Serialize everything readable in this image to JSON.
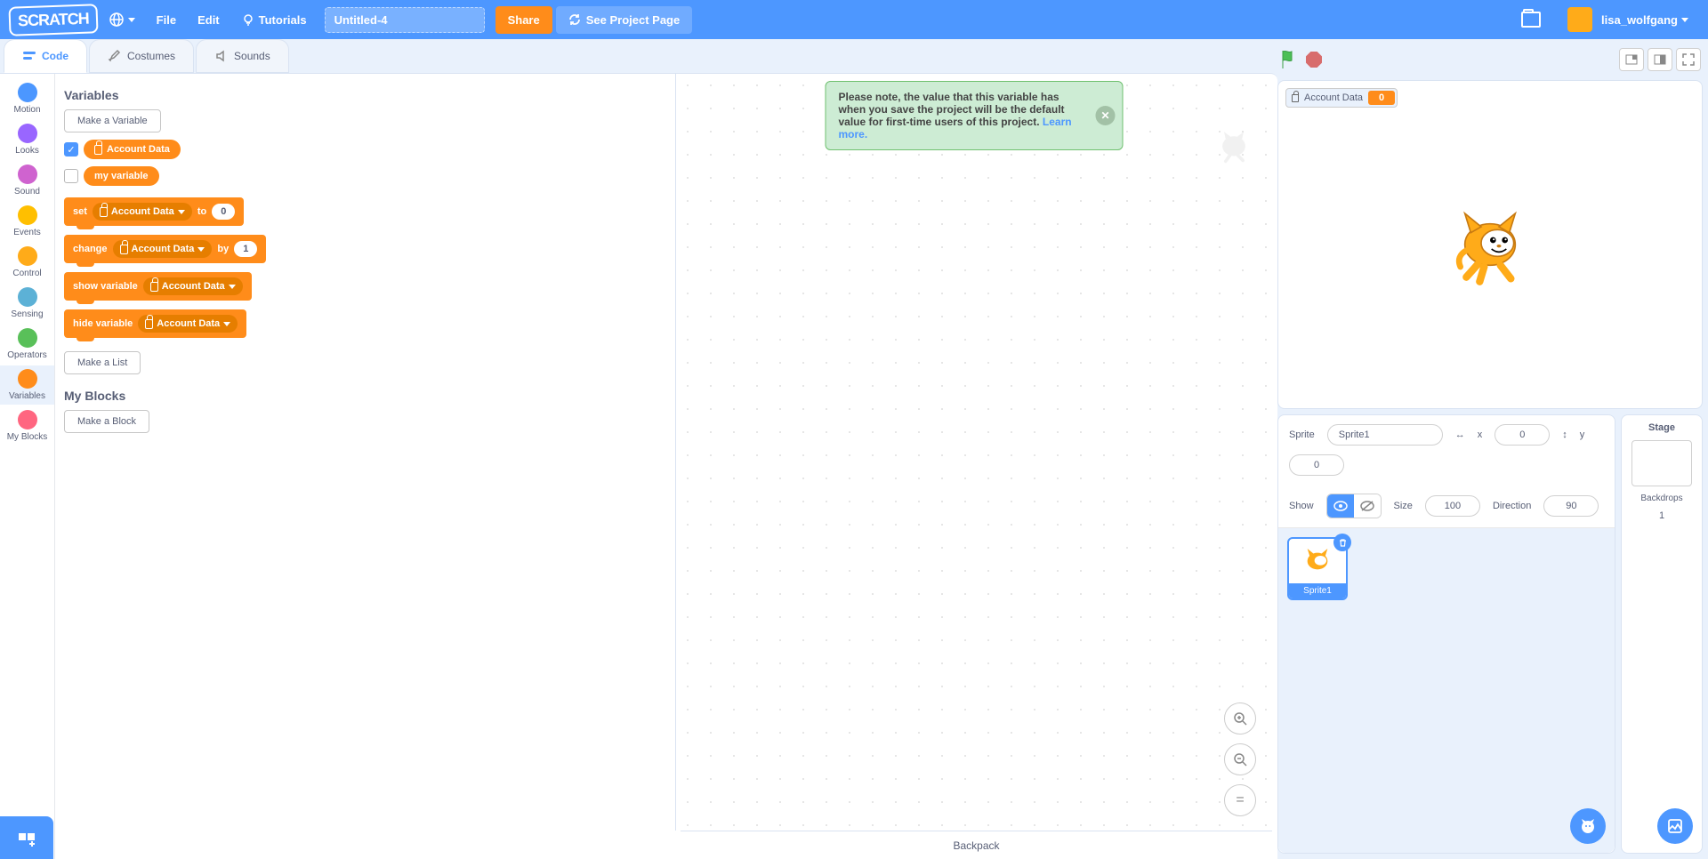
{
  "menubar": {
    "logo": "SCRATCH",
    "file": "File",
    "edit": "Edit",
    "tutorials": "Tutorials",
    "title": "Untitled-4",
    "share": "Share",
    "see_page": "See Project Page",
    "username": "lisa_wolfgang"
  },
  "tabs": {
    "code": "Code",
    "costumes": "Costumes",
    "sounds": "Sounds"
  },
  "categories": [
    {
      "name": "Motion",
      "color": "#4c97ff"
    },
    {
      "name": "Looks",
      "color": "#9966ff"
    },
    {
      "name": "Sound",
      "color": "#cf63cf"
    },
    {
      "name": "Events",
      "color": "#ffbf00"
    },
    {
      "name": "Control",
      "color": "#ffab19"
    },
    {
      "name": "Sensing",
      "color": "#5cb1d6"
    },
    {
      "name": "Operators",
      "color": "#59c059"
    },
    {
      "name": "Variables",
      "color": "#ff8c1a",
      "selected": true
    },
    {
      "name": "My Blocks",
      "color": "#ff6680"
    }
  ],
  "palette": {
    "variables_header": "Variables",
    "make_variable": "Make a Variable",
    "vars": [
      {
        "name": "Account Data",
        "checked": true,
        "cloud": true
      },
      {
        "name": "my variable",
        "checked": false,
        "cloud": false
      }
    ],
    "blocks": {
      "set": {
        "label": "set",
        "to": "to",
        "var": "Account Data",
        "val": "0"
      },
      "change": {
        "label": "change",
        "by": "by",
        "var": "Account Data",
        "val": "1"
      },
      "show": {
        "label": "show variable",
        "var": "Account Data"
      },
      "hide": {
        "label": "hide variable",
        "var": "Account Data"
      }
    },
    "make_list": "Make a List",
    "myblocks_header": "My Blocks",
    "make_block": "Make a Block"
  },
  "alert": {
    "text": "Please note, the value that this variable has when you save the project will be the default value for first-time users of this project. ",
    "link": "Learn more."
  },
  "backpack": "Backpack",
  "stage": {
    "monitor": {
      "name": "Account Data",
      "value": "0"
    }
  },
  "sprite_info": {
    "sprite_label": "Sprite",
    "sprite_name": "Sprite1",
    "x_label": "x",
    "x": "0",
    "y_label": "y",
    "y": "0",
    "show_label": "Show",
    "size_label": "Size",
    "size": "100",
    "dir_label": "Direction",
    "dir": "90"
  },
  "sprite_tile": {
    "name": "Sprite1"
  },
  "stage_panel": {
    "title": "Stage",
    "backdrops_label": "Backdrops",
    "count": "1"
  }
}
